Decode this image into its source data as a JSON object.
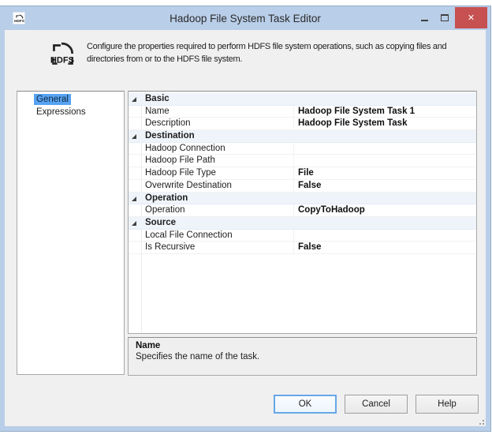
{
  "window": {
    "title": "Hadoop File System Task Editor",
    "close_glyph": "✕"
  },
  "banner": {
    "icon_label": "HDFS",
    "text": "Configure the properties required to perform HDFS file system operations, such as copying files and directories from or to the HDFS file system."
  },
  "sidebar": {
    "items": [
      {
        "label": "General",
        "selected": true
      },
      {
        "label": "Expressions",
        "selected": false
      }
    ]
  },
  "property_grid": {
    "rows": [
      {
        "type": "category",
        "label": "Basic"
      },
      {
        "type": "property",
        "label": "Name",
        "value": "Hadoop File System Task 1"
      },
      {
        "type": "property",
        "label": "Description",
        "value": "Hadoop File System Task"
      },
      {
        "type": "category",
        "label": "Destination"
      },
      {
        "type": "property",
        "label": "Hadoop Connection",
        "value": ""
      },
      {
        "type": "property",
        "label": "Hadoop File Path",
        "value": ""
      },
      {
        "type": "property",
        "label": "Hadoop File Type",
        "value": "File"
      },
      {
        "type": "property",
        "label": "Overwrite Destination",
        "value": "False"
      },
      {
        "type": "category",
        "label": "Operation"
      },
      {
        "type": "property",
        "label": "Operation",
        "value": "CopyToHadoop"
      },
      {
        "type": "category",
        "label": "Source"
      },
      {
        "type": "property",
        "label": "Local File Connection",
        "value": ""
      },
      {
        "type": "property",
        "label": "Is Recursive",
        "value": "False"
      }
    ]
  },
  "help_pane": {
    "title": "Name",
    "text": "Specifies the name of the task."
  },
  "buttons": [
    {
      "label": "OK",
      "default": true
    },
    {
      "label": "Cancel",
      "default": false
    },
    {
      "label": "Help",
      "default": false
    }
  ],
  "colors": {
    "titlebar": "#b9cee8",
    "close_button": "#c75050",
    "selection": "#57a3f2",
    "category_row": "#eff4fa",
    "client_bg": "#f0f0f0"
  }
}
